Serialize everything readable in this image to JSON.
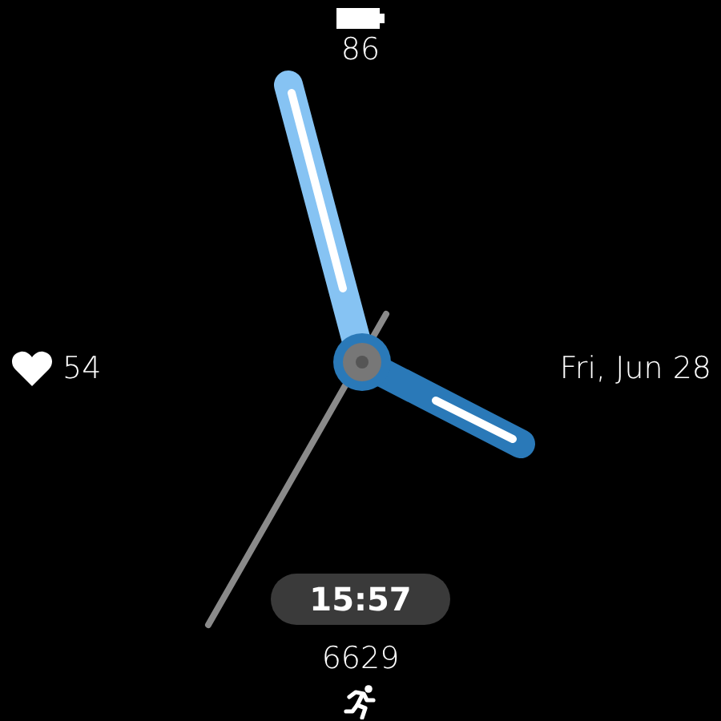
{
  "battery_percent": "86",
  "heart_rate": "54",
  "date": "Fri, Jun 28",
  "digital_time": "15:57",
  "steps": "6629"
}
